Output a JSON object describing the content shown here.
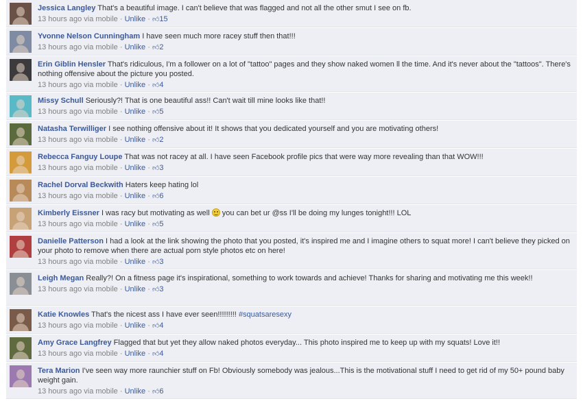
{
  "meta_labels": {
    "time": "13 hours ago via mobile",
    "sep": " · ",
    "unlike": "Unlike"
  },
  "comments": [
    {
      "author": "Jessica Langley",
      "text": "That's a beautiful image. I can't believe that was flagged and not all the other smut I see on fb.",
      "likes": "15",
      "avatar_color": "#6b5248"
    },
    {
      "author": "Yvonne Nelson Cunningham",
      "text": "I have seen much more racey stuff then that!!!",
      "likes": "2",
      "avatar_color": "#7f8aa3"
    },
    {
      "author": "Erin Giblin Hensler",
      "text": "That's ridiculous, I'm a follower on a lot of \"tattoo\" pages and they show naked women ll the time. And it's never about the \"tattoos\". There's nothing offensive about the picture you posted.",
      "likes": "4",
      "avatar_color": "#3c3a3c"
    },
    {
      "author": "Missy Schull",
      "text": "Seriously?! That is one beautiful ass!! Can't wait till mine looks like that!!",
      "likes": "5",
      "avatar_color": "#5ab9c7"
    },
    {
      "author": "Natasha Terwilliger",
      "text": "I see nothing offensive about it! It shows that you dedicated yourself and you are motivating others!",
      "likes": "2",
      "avatar_color": "#5c6b3d"
    },
    {
      "author": "Rebecca Fanguy Loupe",
      "text": "That was not racey at all. I have seen Facebook profile pics that were way more revealing than that WOW!!!",
      "likes": "3",
      "avatar_color": "#d49b3c"
    },
    {
      "author": "Rachel Dorval Beckwith",
      "text": "Haters keep hating lol",
      "likes": "6",
      "avatar_color": "#b88a5a"
    },
    {
      "author": "Kimberly Eissner",
      "text_before": "I was racy but motivating as well",
      "text_after": "you can bet ur @ss I'll be doing my lunges tonight!!! LOL",
      "emoji": "smile-emoji",
      "likes": "5",
      "avatar_color": "#c7a276"
    },
    {
      "author": "Danielle Patterson",
      "text": "I had a look at the link showing the photo that you posted, it's inspired me and I imagine others to squat more! I can't believe they picked on your photo to remove when there are actual porn style photos etc on here!",
      "likes": "3",
      "avatar_color": "#b04040"
    },
    {
      "author": "Leigh Megan",
      "text": "Really?! On a fitness page it's inspirational, something to work towards and achieve! Thanks for sharing and motivating me this week!!",
      "likes": "3",
      "avatar_color": "#8a8f95"
    },
    {
      "author": "Katie Knowles",
      "text": "That's the nicest ass I have ever seen!!!!!!!!!",
      "hashtag": "#squatsaresexy",
      "likes": "4",
      "avatar_color": "#7a5a48"
    },
    {
      "author": "Amy Grace Langfrey",
      "text": "Flagged that but yet they allow naked photos everyday... This photo inspired me to keep up with my squats! Love it!!",
      "likes": "4",
      "avatar_color": "#5f6a3f"
    },
    {
      "author": "Tera Marion",
      "text": "I've seen way more raunchier stuff on Fb! Obviously somebody was jealous...This is the motivational stuff I need to get rid of my 50+ pound baby weight gain.",
      "likes": "6",
      "avatar_color": "#9c7ab0"
    }
  ]
}
